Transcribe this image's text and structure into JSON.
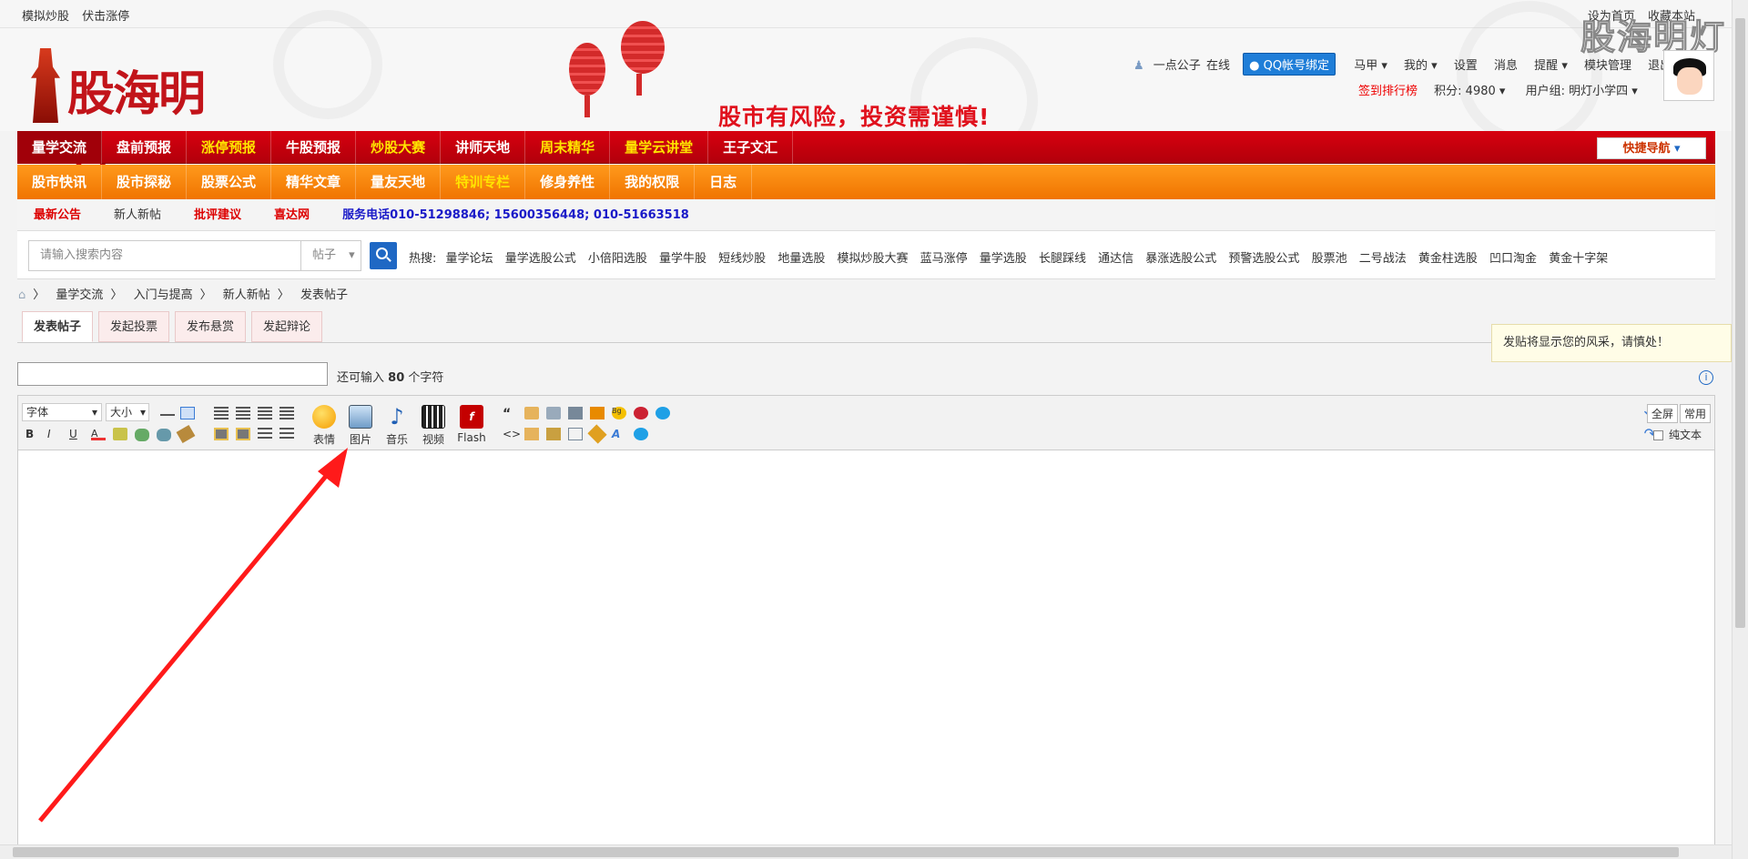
{
  "topbar": {
    "left": [
      "模拟炒股",
      "伏击涨停"
    ],
    "right": [
      "设为首页",
      "收藏本站"
    ]
  },
  "watermark": "股海明灯",
  "logo": {
    "text": "股海明灯"
  },
  "slogan": "股市有风险，投资需谨慎!",
  "user": {
    "name": "一点公子",
    "status": "在线",
    "qq_bind": "QQ帐号绑定",
    "menu": [
      "马甲",
      "我的",
      "设置",
      "消息",
      "提醒",
      "模块管理",
      "退出"
    ],
    "sign_rank": "签到排行榜",
    "points": "积分: 4980",
    "group": "用户组: 明灯小学四"
  },
  "nav1": {
    "items": [
      {
        "label": "量学交流",
        "active": true,
        "highlight": false
      },
      {
        "label": "盘前预报",
        "active": false,
        "highlight": false
      },
      {
        "label": "涨停预报",
        "active": false,
        "highlight": true
      },
      {
        "label": "牛股预报",
        "active": false,
        "highlight": false
      },
      {
        "label": "炒股大赛",
        "active": false,
        "highlight": true
      },
      {
        "label": "讲师天地",
        "active": false,
        "highlight": false
      },
      {
        "label": "周末精华",
        "active": false,
        "highlight": true
      },
      {
        "label": "量学云讲堂",
        "active": false,
        "highlight": true
      },
      {
        "label": "王子文汇",
        "active": false,
        "highlight": false
      }
    ],
    "quick_nav": "快捷导航"
  },
  "nav2": {
    "items": [
      {
        "label": "股市快讯",
        "highlight": false
      },
      {
        "label": "股市探秘",
        "highlight": false
      },
      {
        "label": "股票公式",
        "highlight": false
      },
      {
        "label": "精华文章",
        "highlight": false
      },
      {
        "label": "量友天地",
        "highlight": false
      },
      {
        "label": "特训专栏",
        "highlight": true
      },
      {
        "label": "修身养性",
        "highlight": false
      },
      {
        "label": "我的权限",
        "highlight": false
      },
      {
        "label": "日志",
        "highlight": false
      }
    ]
  },
  "nav3": {
    "items": [
      "最新公告",
      "新人新帖",
      "批评建议",
      "喜达网"
    ],
    "phone": "服务电话010-51298846; 15600356448; 010-51663518"
  },
  "search": {
    "placeholder": "请输入搜索内容",
    "type": "帖子",
    "hot_label": "热搜:",
    "hot": [
      "量学论坛",
      "量学选股公式",
      "小倍阳选股",
      "量学牛股",
      "短线炒股",
      "地量选股",
      "模拟炒股大赛",
      "蓝马涨停",
      "量学选股",
      "长腿踩线",
      "通达信",
      "暴涨选股公式",
      "预警选股公式",
      "股票池",
      "二号战法",
      "黄金柱选股",
      "凹口淘金",
      "黄金十字架"
    ]
  },
  "breadcrumb": [
    "量学交流",
    "入门与提高",
    "新人新帖",
    "发表帖子"
  ],
  "tabs": [
    "发表帖子",
    "发起投票",
    "发布悬赏",
    "发起辩论"
  ],
  "tip": "发贴将显示您的风采，请慎处！",
  "title_field": {
    "value": "",
    "remain_prefix": "还可输入",
    "remain_count": "80",
    "remain_suffix": "个字符"
  },
  "editor": {
    "font_select": "字体",
    "size_select": "大小",
    "big_buttons": [
      "表情",
      "图片",
      "音乐",
      "视频",
      "Flash"
    ],
    "fullscreen": "全屏",
    "common": "常用",
    "plain_text": "纯文本"
  }
}
